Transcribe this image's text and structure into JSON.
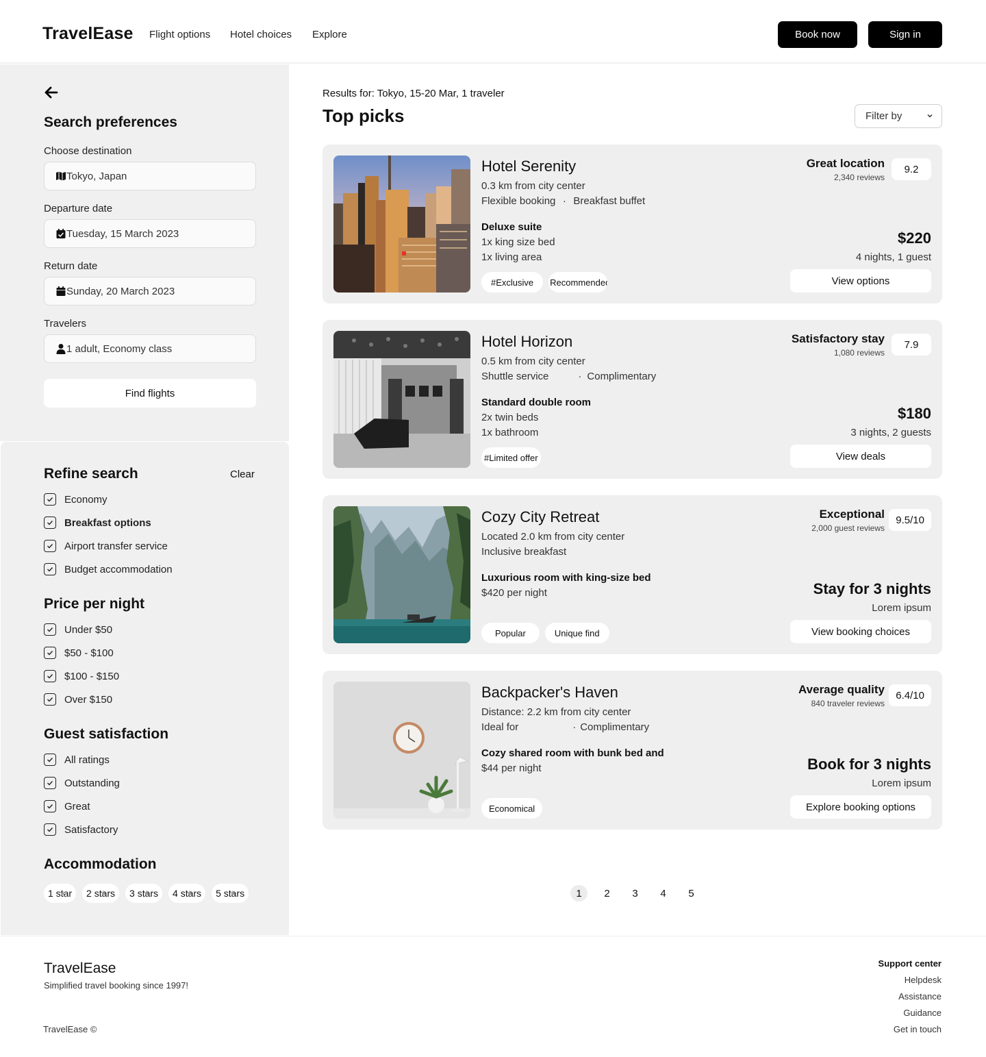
{
  "brand": "TravelEase",
  "nav": [
    "Flight options",
    "Hotel choices",
    "Explore"
  ],
  "header_buttons": {
    "book": "Book now",
    "sign_in": "Sign in"
  },
  "sidebar": {
    "title": "Search preferences",
    "destination": {
      "label": "Choose destination",
      "value": "Tokyo, Japan"
    },
    "departure": {
      "label": "Departure date",
      "value": "Tuesday, 15 March 2023"
    },
    "return": {
      "label": "Return date",
      "value": "Sunday, 20 March 2023"
    },
    "travelers": {
      "label": "Travelers",
      "value": "1 adult, Economy class"
    },
    "find_button": "Find flights"
  },
  "refine": {
    "title": "Refine search",
    "clear": "Clear",
    "options": [
      "Economy",
      "Breakfast options",
      "Airport transfer service",
      "Budget accommodation"
    ],
    "price_title": "Price per night",
    "prices": [
      "Under $50",
      "$50 - $100",
      "$100 - $150",
      "Over $150"
    ],
    "satisfaction_title": "Guest satisfaction",
    "satisfaction": [
      "All ratings",
      "Outstanding",
      "Great",
      "Satisfactory"
    ],
    "accommodation_title": "Accommodation",
    "stars": [
      "1 star",
      "2 stars",
      "3 stars",
      "4 stars",
      "5 stars"
    ]
  },
  "main": {
    "results_for": "Results for: Tokyo, 15-20 Mar, 1 traveler",
    "title": "Top picks",
    "filter": "Filter by"
  },
  "hotels": [
    {
      "name": "Hotel Serenity",
      "line1": "0.3 km from city center",
      "feat1": "Flexible booking",
      "feat2": "Breakfast buffet",
      "room": "Deluxe suite",
      "detail1": "1x king size bed",
      "detail2": "1x living area",
      "tags": [
        "#Exclusive",
        "Recommended"
      ],
      "rating_label": "Great location",
      "reviews": "2,340 reviews",
      "score": "9.2",
      "price": "$220",
      "price_sub": "4 nights, 1 guest",
      "cta": "View options"
    },
    {
      "name": "Hotel Horizon",
      "line1": "0.5 km from city center",
      "feat1": "Shuttle service",
      "feat2": "Complimentary",
      "room": "Standard double room",
      "detail1": "2x twin beds",
      "detail2": "1x bathroom",
      "tags": [
        "#Limited offer"
      ],
      "rating_label": "Satisfactory stay",
      "reviews": "1,080 reviews",
      "score": "7.9",
      "price": "$180",
      "price_sub": "3 nights, 2 guests",
      "cta": "View deals"
    },
    {
      "name": "Cozy City Retreat",
      "line1": "Located 2.0 km from city center",
      "feat1": "Inclusive breakfast",
      "feat2": "",
      "room": "Luxurious room with king-size bed",
      "detail1": "$420 per night",
      "detail2": "",
      "tags": [
        "Popular",
        "Unique find"
      ],
      "rating_label": "Exceptional",
      "reviews": "2,000 guest reviews",
      "score": "9.5/10",
      "price": "Stay for 3 nights",
      "price_sub": "Lorem ipsum",
      "cta": "View booking choices"
    },
    {
      "name": "Backpacker's Haven",
      "line1": "Distance: 2.2 km from city center",
      "feat1": "Ideal for",
      "feat2": "Complimentary",
      "room": "Cozy shared room with bunk bed and",
      "detail1": "$44 per night",
      "detail2": "",
      "tags": [
        "Economical"
      ],
      "rating_label": "Average quality",
      "reviews": "840 traveler reviews",
      "score": "6.4/10",
      "price": "Book for 3 nights",
      "price_sub": "Lorem ipsum",
      "cta": "Explore booking options"
    }
  ],
  "pagination": [
    "1",
    "2",
    "3",
    "4",
    "5"
  ],
  "footer": {
    "brand": "TravelEase",
    "tagline": "Simplified travel booking since 1997!",
    "copyright": "TravelEase ©",
    "support_title": "Support center",
    "links": [
      "Helpdesk",
      "Assistance",
      "Guidance",
      "Get in touch"
    ]
  },
  "icons": {
    "back": "arrow-left-icon",
    "destination": "map-icon",
    "departure": "calendar-check-icon",
    "return": "calendar-icon",
    "travelers": "user-icon",
    "filter": "chevron-down-icon",
    "checkbox": "check-icon"
  }
}
